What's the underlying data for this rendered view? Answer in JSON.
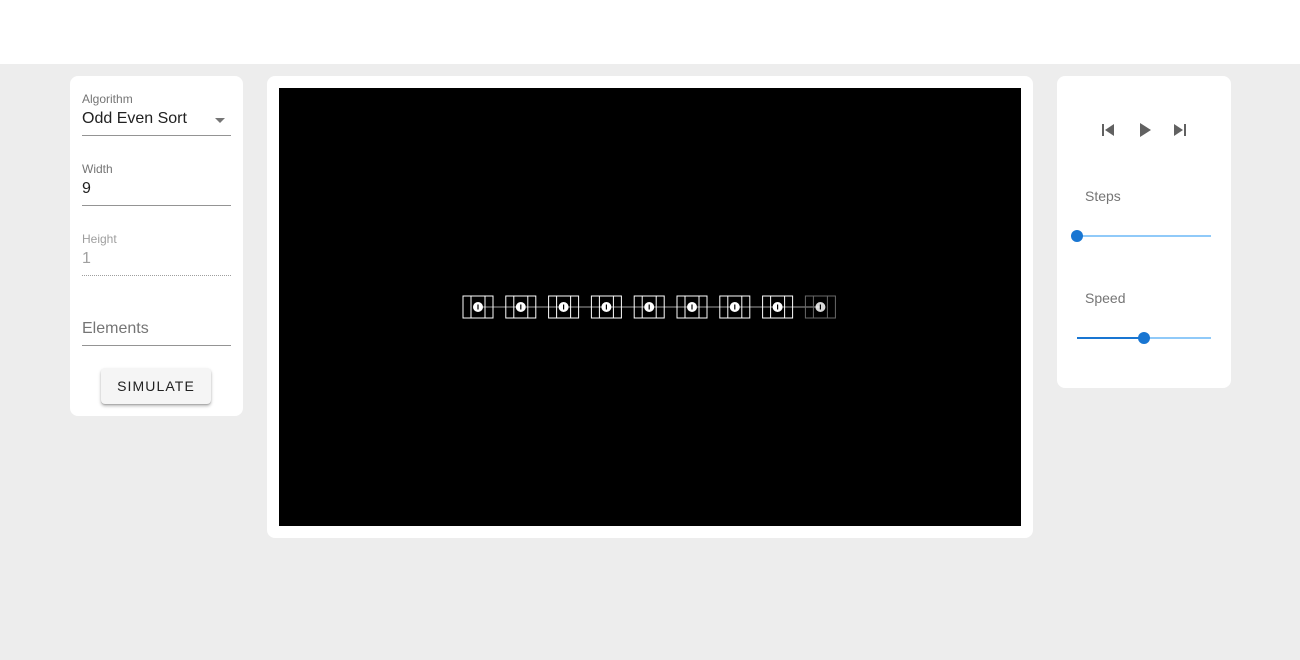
{
  "controls": {
    "algorithm": {
      "label": "Algorithm",
      "value": "Odd Even Sort"
    },
    "width": {
      "label": "Width",
      "value": "9"
    },
    "height": {
      "label": "Height",
      "value": "1"
    },
    "elements": {
      "placeholder": "Elements"
    },
    "simulate_label": "SIMULATE"
  },
  "network": {
    "nodes": 9,
    "active_nodes": 8
  },
  "playback": {
    "buttons": [
      "skip-previous-icon",
      "play-icon",
      "skip-next-icon"
    ],
    "steps": {
      "label": "Steps",
      "value": 0
    },
    "speed": {
      "label": "Speed",
      "value": 0.5
    }
  },
  "colors": {
    "accent": "#1976d2",
    "accent_light": "#90caf9",
    "canvas_bg": "#000000"
  }
}
